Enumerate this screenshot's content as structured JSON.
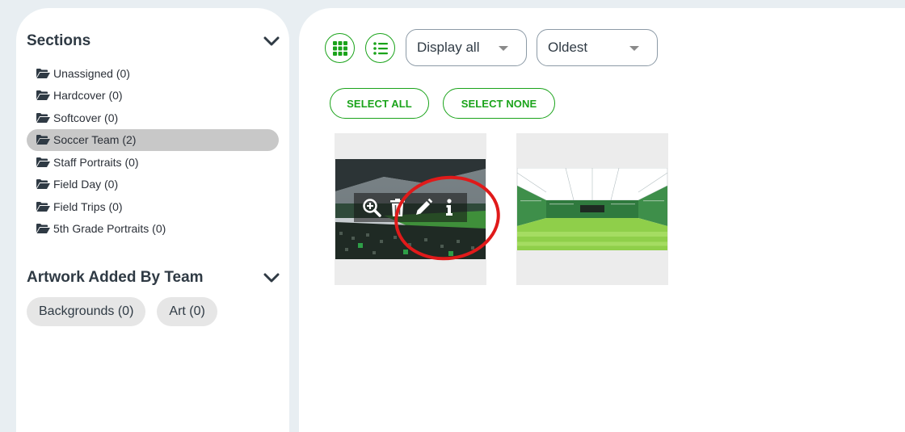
{
  "sidebar": {
    "sections": {
      "title": "Sections",
      "items": [
        {
          "label": "Unassigned (0)"
        },
        {
          "label": "Hardcover (0)"
        },
        {
          "label": "Softcover (0)"
        },
        {
          "label": "Soccer Team (2)",
          "active": true
        },
        {
          "label": "Staff Portraits (0)"
        },
        {
          "label": "Field Day (0)"
        },
        {
          "label": "Field Trips (0)"
        },
        {
          "label": "5th Grade Portraits (0)"
        }
      ]
    },
    "artwork": {
      "title": "Artwork Added By Team",
      "chips": [
        {
          "label": "Backgrounds (0)"
        },
        {
          "label": "Art (0)"
        }
      ]
    }
  },
  "toolbar": {
    "display_filter": "Display all",
    "sort_order": "Oldest",
    "grid_view_icon": "grid-icon",
    "list_view_icon": "list-icon"
  },
  "actions": {
    "select_all": "SELECT ALL",
    "select_none": "SELECT NONE"
  },
  "photos": [
    {
      "name": "stadium-crowd-photo",
      "overlay_icons": [
        "zoom-in-icon",
        "trash-icon",
        "pencil-icon",
        "info-icon"
      ]
    },
    {
      "name": "stadium-field-photo"
    }
  ],
  "colors": {
    "accent_green": "#1aa31a",
    "annotation_red": "#e01a1a",
    "active_item_bg": "#c8c8c8",
    "page_bg": "#e8eef2"
  }
}
